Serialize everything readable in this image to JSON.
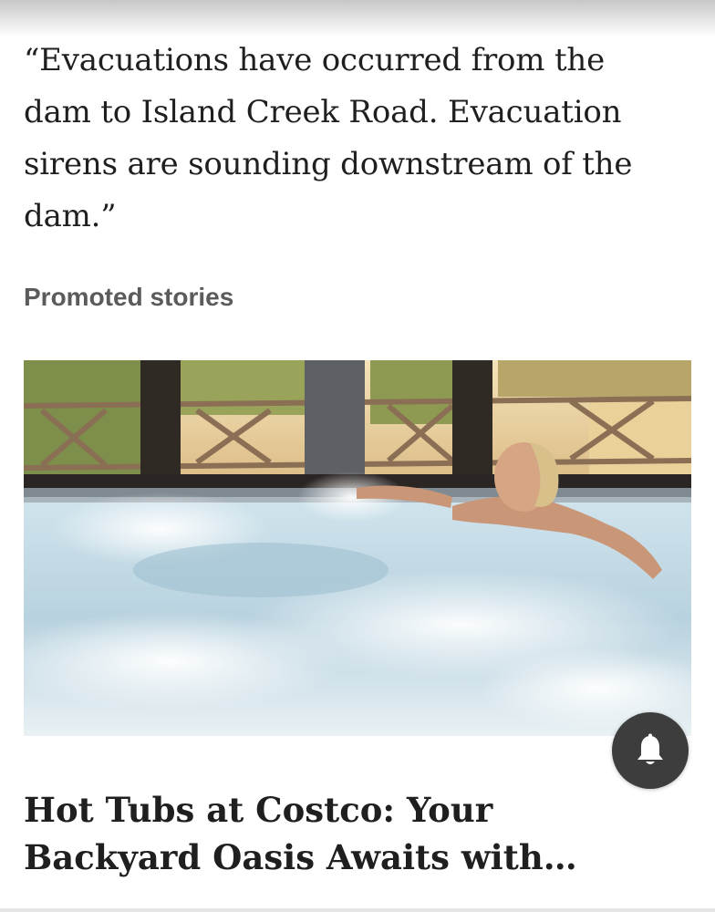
{
  "article": {
    "quote": "“Evacuations have occurred from the dam to Island Creek Road. Evacuation sirens are sounding downstream of the dam.”"
  },
  "promoted": {
    "section_label": "Promoted stories",
    "card": {
      "image_icon": "hot-tub-photo",
      "headline": "Hot Tubs at Costco: Your Backyard Oasis Awaits with…"
    }
  },
  "notification_button": {
    "icon": "bell-icon",
    "color": "#3d3d3d"
  }
}
